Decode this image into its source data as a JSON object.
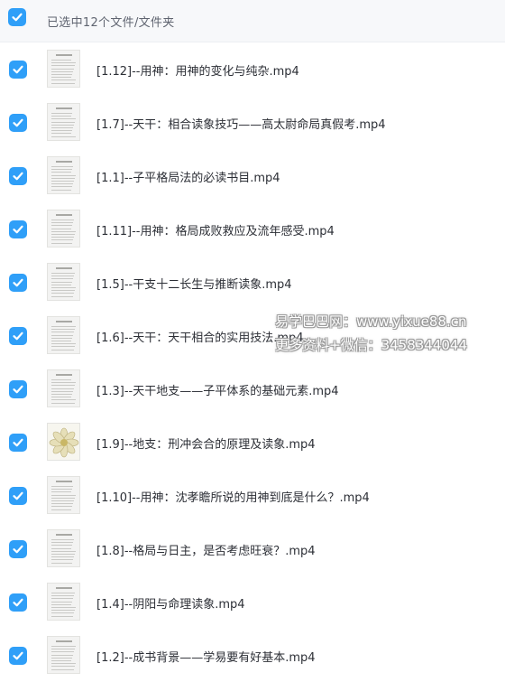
{
  "header": {
    "select_all_checked": true,
    "title": "已选中12个文件/文件夹"
  },
  "files": [
    {
      "name": "[1.12]--用神：用神的变化与纯杂.mp4",
      "checked": true,
      "thumb": "document"
    },
    {
      "name": "[1.7]--天干：相合读象技巧——高太尉命局真假考.mp4",
      "checked": true,
      "thumb": "document"
    },
    {
      "name": "[1.1]--子平格局法的必读书目.mp4",
      "checked": true,
      "thumb": "document"
    },
    {
      "name": "[1.11]--用神：格局成败救应及流年感受.mp4",
      "checked": true,
      "thumb": "document"
    },
    {
      "name": "[1.5]--干支十二长生与推断读象.mp4",
      "checked": true,
      "thumb": "document"
    },
    {
      "name": "[1.6]--天干：天干相合的实用技法.mp4",
      "checked": true,
      "thumb": "document"
    },
    {
      "name": "[1.3]--天干地支——子平体系的基础元素.mp4",
      "checked": true,
      "thumb": "document"
    },
    {
      "name": "[1.9]--地支：刑冲会合的原理及读象.mp4",
      "checked": true,
      "thumb": "flower"
    },
    {
      "name": "[1.10]--用神：沈孝瞻所说的用神到底是什么？.mp4",
      "checked": true,
      "thumb": "document"
    },
    {
      "name": "[1.8]--格局与日主，是否考虑旺衰？.mp4",
      "checked": true,
      "thumb": "document"
    },
    {
      "name": "[1.4]--阴阳与命理读象.mp4",
      "checked": true,
      "thumb": "document"
    },
    {
      "name": "[1.2]--成书背景——学易要有好基本.mp4",
      "checked": true,
      "thumb": "document"
    }
  ],
  "watermark": {
    "line1": "易学巴巴网：www.yixue88.cn",
    "line2": "更多资料+微信：3458344044"
  },
  "colors": {
    "checkbox": "#2f9ff8",
    "header_bg": "#f7f8fa",
    "text": "#2c2f36"
  }
}
